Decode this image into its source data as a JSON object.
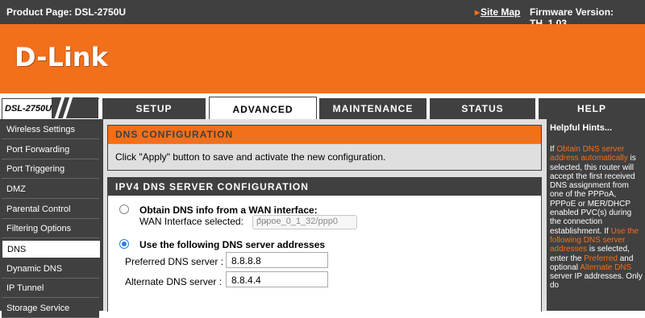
{
  "header": {
    "product": "Product Page: DSL-2750U",
    "site_map": "Site Map",
    "firmware": "Firmware Version: TH_1.03"
  },
  "brand": {
    "logo": "D-Link",
    "accent_color": "#f26f1b",
    "dark_color": "#404040"
  },
  "nav": {
    "model": "DSL-2750U",
    "tabs": [
      {
        "label": "SETUP",
        "active": false
      },
      {
        "label": "ADVANCED",
        "active": true
      },
      {
        "label": "MAINTENANCE",
        "active": false
      },
      {
        "label": "STATUS",
        "active": false
      },
      {
        "label": "HELP",
        "active": false
      }
    ]
  },
  "sidebar": {
    "items": [
      {
        "label": "Wireless Settings"
      },
      {
        "label": "Port Forwarding"
      },
      {
        "label": "Port Triggering"
      },
      {
        "label": "DMZ"
      },
      {
        "label": "Parental Control"
      },
      {
        "label": "Filtering Options"
      },
      {
        "label": "DNS",
        "active": true
      },
      {
        "label": "Dynamic DNS"
      },
      {
        "label": "IP Tunnel"
      },
      {
        "label": "Storage Service"
      }
    ]
  },
  "dns_config": {
    "title": "DNS CONFIGURATION",
    "description": "Click \"Apply\" button to save and activate the new configuration."
  },
  "ipv4": {
    "title": "IPV4 DNS SERVER CONFIGURATION",
    "option_wan": "Obtain DNS info from a WAN interface:",
    "wan_interface_label": "WAN Interface selected:",
    "wan_interface_value": "pppoe_0_1_32/ppp0",
    "option_static": "Use the following DNS server addresses",
    "selected_option": "static",
    "preferred_label": "Preferred DNS server :",
    "preferred_value": "8.8.8.8",
    "alternate_label": "Alternate DNS server :",
    "alternate_value": "8.8.4.4"
  },
  "hints": {
    "title": "Helpful Hints...",
    "p1": "If ",
    "p1_hl": "Obtain DNS server address automatically",
    "p2": " is selected, this router will accept the first received DNS assignment from one of the PPPoA, PPPoE or MER/DHCP enabled PVC(s) during the connection establishment. If ",
    "p2_hl": "Use the following DNS server addresses",
    "p3": " is selected, enter the ",
    "p3_hl": "Preferred",
    "p4": " and optional ",
    "p4_hl": "Alternate DNS",
    "p5": " server IP addresses. Only do"
  }
}
